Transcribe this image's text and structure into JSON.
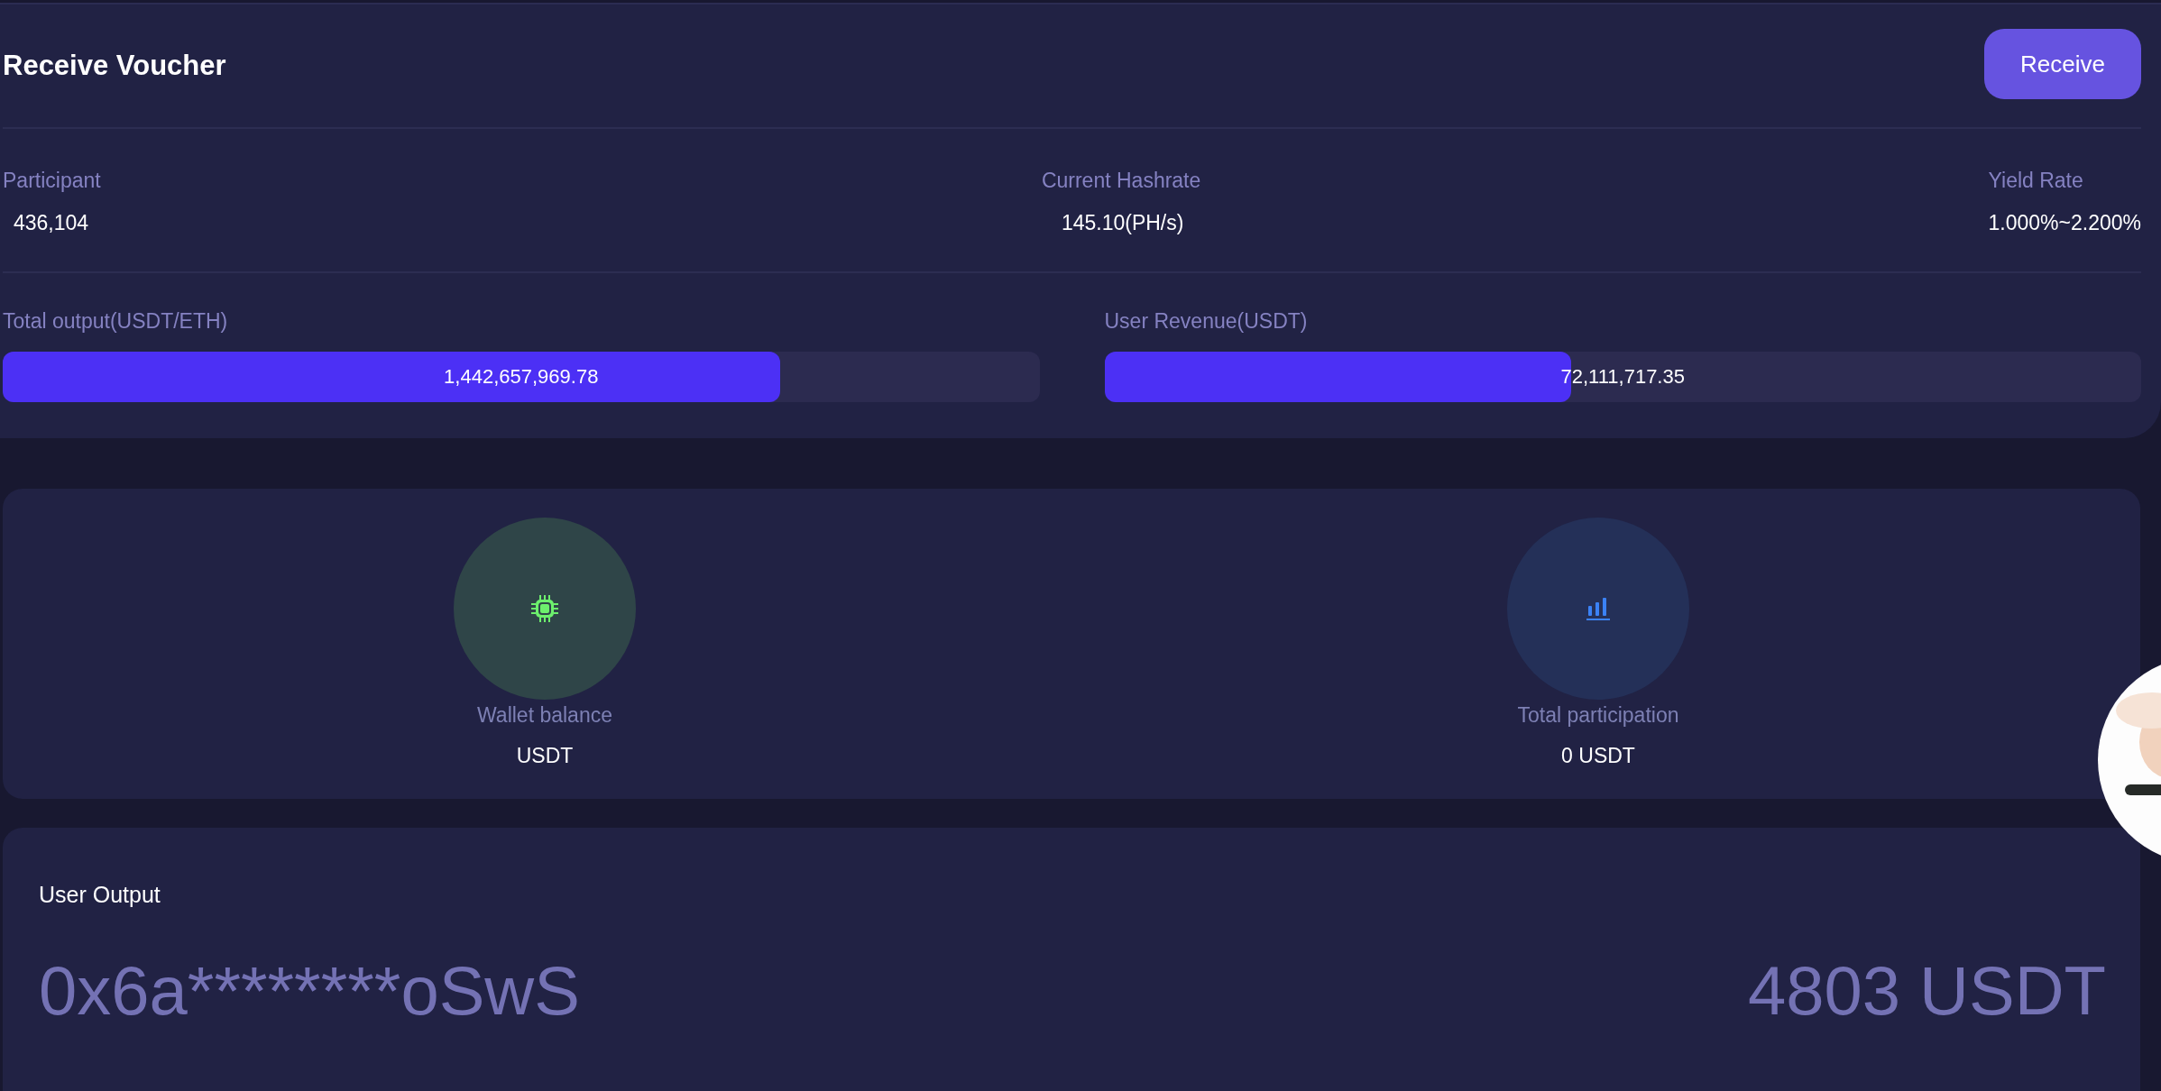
{
  "header": {
    "title": "Receive Voucher",
    "button": "Receive"
  },
  "stats": [
    {
      "label": "Participant",
      "value": "436,104"
    },
    {
      "label": "Current Hashrate",
      "value": "145.10(PH/s)"
    },
    {
      "label": "Yield Rate",
      "value": "1.000%~2.200%"
    }
  ],
  "progress": [
    {
      "label": "Total output(USDT/ETH)",
      "value": "1,442,657,969.78",
      "level": 0.75
    },
    {
      "label": "User Revenue(USDT)",
      "value": "72,111,717.35",
      "level": 0.45
    }
  ],
  "balances": [
    {
      "kind": "chip",
      "label": "Wallet balance",
      "value": "USDT"
    },
    {
      "kind": "bars",
      "label": "Total participation",
      "value": "0 USDT"
    }
  ],
  "user_output": {
    "title": "User Output",
    "address": "0x6a********oSwS",
    "amount": "4803 USDT"
  }
}
